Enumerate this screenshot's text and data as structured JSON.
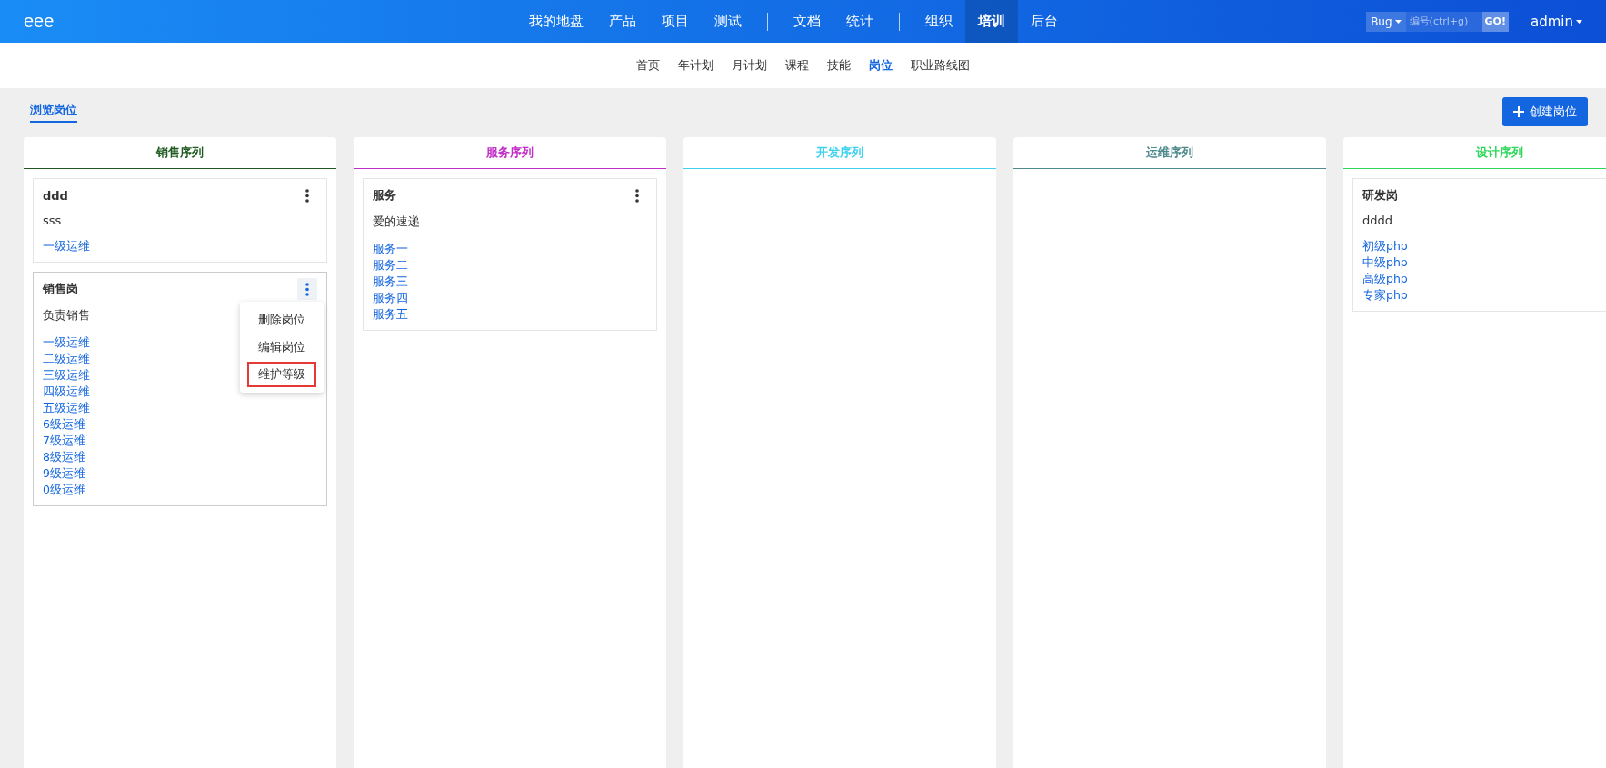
{
  "top_bar": {
    "logo": "eee",
    "nav_groups": [
      [
        {
          "label": "我的地盘",
          "selected": false
        },
        {
          "label": "产品",
          "selected": false
        },
        {
          "label": "项目",
          "selected": false
        },
        {
          "label": "测试",
          "selected": false
        }
      ],
      [
        {
          "label": "文档",
          "selected": false
        },
        {
          "label": "统计",
          "selected": false
        }
      ],
      [
        {
          "label": "组织",
          "selected": false
        },
        {
          "label": "培训",
          "selected": true
        },
        {
          "label": "后台",
          "selected": false
        }
      ]
    ],
    "search_type": "Bug",
    "search": {
      "placeholder": "编号(ctrl+g)"
    },
    "go_button": "GO!",
    "user": "admin"
  },
  "sub_nav": [
    {
      "label": "首页",
      "selected": false
    },
    {
      "label": "年计划",
      "selected": false
    },
    {
      "label": "月计划",
      "selected": false
    },
    {
      "label": "课程",
      "selected": false
    },
    {
      "label": "技能",
      "selected": false
    },
    {
      "label": "岗位",
      "selected": true
    },
    {
      "label": "职业路线图",
      "selected": false
    }
  ],
  "page_tab": {
    "label": "浏览岗位",
    "selected": true
  },
  "create_button": "创建岗位",
  "columns": [
    {
      "title": "销售序列",
      "color": "#1e5a1e",
      "cards": [
        {
          "title": "ddd",
          "description": "sss",
          "menu_open": false,
          "levels": [
            "一级运维"
          ]
        },
        {
          "title": "销售岗",
          "description": "负责销售",
          "menu_open": true,
          "menu_items": [
            {
              "label": "删除岗位",
              "highlighted": false
            },
            {
              "label": "编辑岗位",
              "highlighted": false
            },
            {
              "label": "维护等级",
              "highlighted": true
            }
          ],
          "levels": [
            "一级运维",
            "二级运维",
            "三级运维",
            "四级运维",
            "五级运维",
            "6级运维",
            "7级运维",
            "8级运维",
            "9级运维",
            "0级运维"
          ]
        }
      ]
    },
    {
      "title": "服务序列",
      "color": "#c22fc8",
      "cards": [
        {
          "title": "服务",
          "description": "爱的速递",
          "menu_open": false,
          "levels": [
            "服务一",
            "服务二",
            "服务三",
            "服务四",
            "服务五"
          ]
        }
      ]
    },
    {
      "title": "开发序列",
      "color": "#3fd2f0"
    },
    {
      "title": "运维序列",
      "color": "#4e8a8c"
    },
    {
      "title": "设计序列",
      "color": "#2ed95a",
      "cards": [
        {
          "title": "研发岗",
          "description": "dddd",
          "levels": [
            "初级php",
            "中级php",
            "高级php",
            "专家php"
          ]
        }
      ]
    }
  ]
}
